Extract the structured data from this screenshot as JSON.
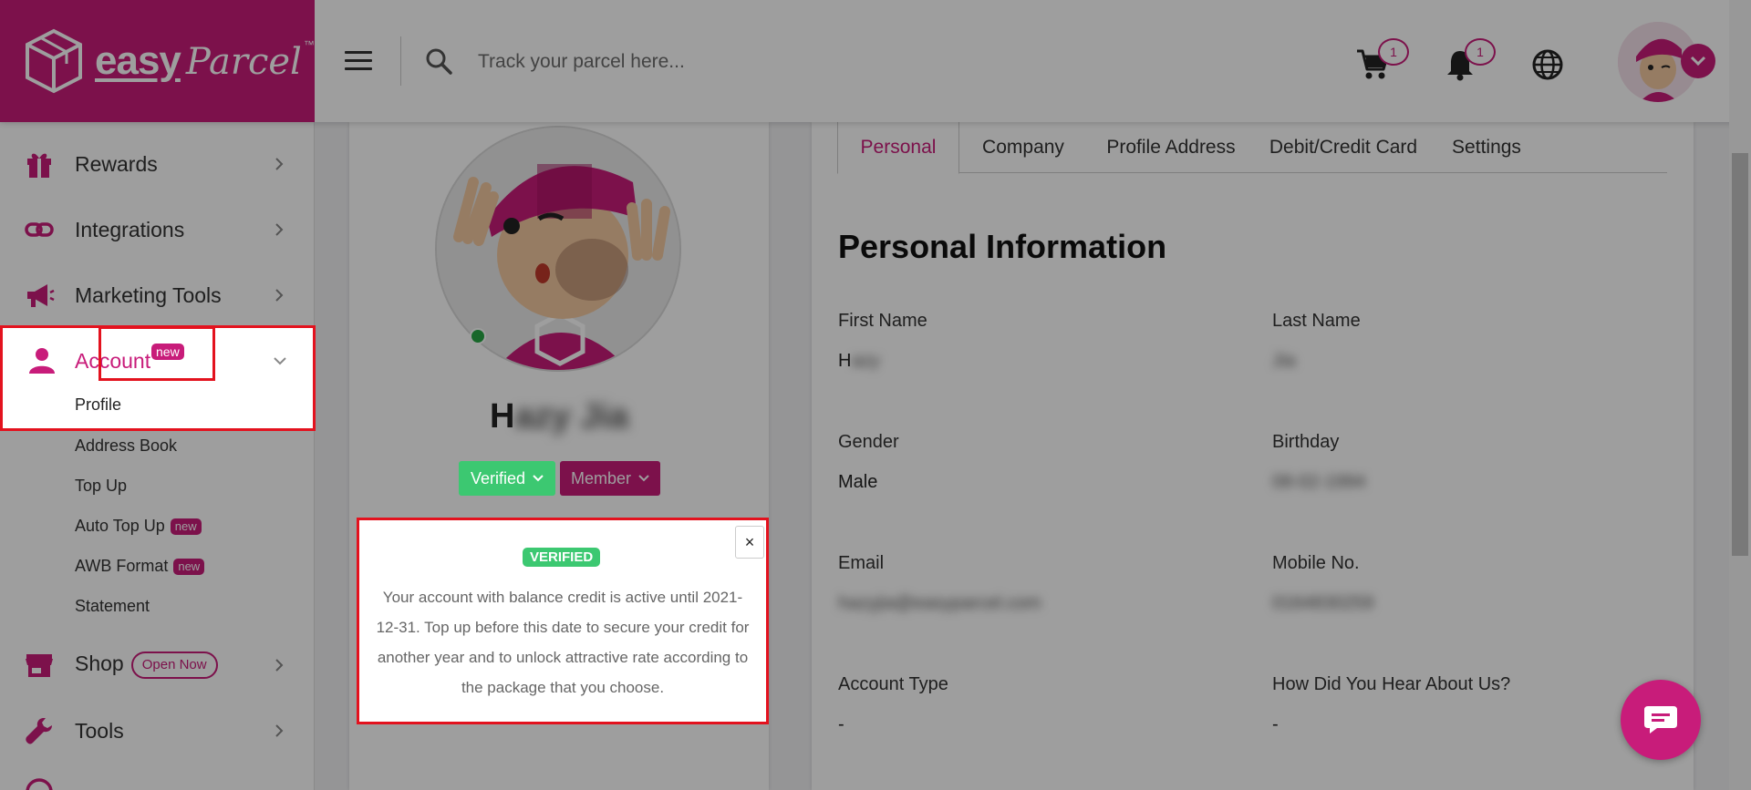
{
  "brand": {
    "name_part1": "easy",
    "name_part2": "Parcel",
    "tm": "™",
    "color": "#c81c7a"
  },
  "header": {
    "search_placeholder": "Track your parcel here...",
    "cart_count": "1",
    "notification_count": "1"
  },
  "sidebar": {
    "items": [
      {
        "label": "Rewards",
        "icon": "gift-icon"
      },
      {
        "label": "Integrations",
        "icon": "link-icon"
      },
      {
        "label": "Marketing Tools",
        "icon": "megaphone-icon"
      },
      {
        "label": "Account",
        "icon": "user-icon",
        "badge": "new",
        "expanded": true
      },
      {
        "label": "Shop",
        "icon": "shop-icon",
        "badge": "Open Now"
      },
      {
        "label": "Tools",
        "icon": "wrench-icon"
      }
    ],
    "account_subitems": [
      {
        "label": "Profile",
        "active": true
      },
      {
        "label": "Address Book"
      },
      {
        "label": "Top Up"
      },
      {
        "label": "Auto Top Up",
        "badge": "new"
      },
      {
        "label": "AWB Format",
        "badge": "new"
      },
      {
        "label": "Statement"
      }
    ]
  },
  "profile": {
    "name_initial": "H",
    "name_rest": "azy Jia",
    "verified_label": "Verified",
    "member_label": "Member"
  },
  "popover": {
    "badge": "VERIFIED",
    "close": "×",
    "text": "Your account with balance credit is active until 2021-12-31. Top up before this date to secure your credit for another year and to unlock attractive rate according to the package that you choose."
  },
  "tabs": [
    "Personal",
    "Company",
    "Profile Address",
    "Debit/Credit Card",
    "Settings"
  ],
  "active_tab": "Personal",
  "info": {
    "title": "Personal Information",
    "first_name_label": "First Name",
    "first_name_initial": "H",
    "first_name_rest": "azy",
    "last_name_label": "Last Name",
    "last_name_value": "Jia",
    "gender_label": "Gender",
    "gender_value": "Male",
    "birthday_label": "Birthday",
    "birthday_value": "08-02-1994",
    "email_label": "Email",
    "email_value": "hazyjia@easyparcel.com",
    "mobile_label": "Mobile No.",
    "mobile_value": "0164830259",
    "account_type_label": "Account Type",
    "account_type_value": "-",
    "hear_label": "How Did You Hear About Us?",
    "hear_value": "-"
  },
  "colors": {
    "accent": "#c81c7a",
    "verified": "#3cc871",
    "highlight": "#e3121e"
  }
}
